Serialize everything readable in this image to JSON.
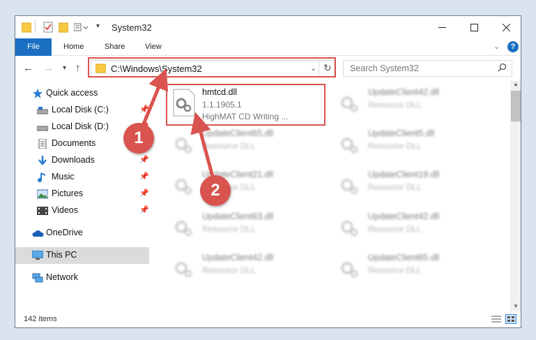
{
  "window": {
    "title": "System32",
    "minimize_icon": "minimize-icon",
    "maximize_icon": "maximize-icon",
    "close_icon": "close-icon"
  },
  "ribbon": {
    "tabs": [
      "File",
      "Home",
      "Share",
      "View"
    ]
  },
  "address": {
    "path": "C:\\Windows\\System32",
    "search_placeholder": "Search System32"
  },
  "sidebar": {
    "items": [
      {
        "label": "Quick access",
        "pinned": false
      },
      {
        "label": "Local Disk (C:)",
        "pinned": true
      },
      {
        "label": "Local Disk (D:)",
        "pinned": true
      },
      {
        "label": "Documents",
        "pinned": true
      },
      {
        "label": "Downloads",
        "pinned": true
      },
      {
        "label": "Music",
        "pinned": true
      },
      {
        "label": "Pictures",
        "pinned": true
      },
      {
        "label": "Videos",
        "pinned": true
      },
      {
        "label": "OneDrive",
        "pinned": false
      },
      {
        "label": "This PC",
        "pinned": false
      },
      {
        "label": "Network",
        "pinned": false
      }
    ]
  },
  "files": {
    "highlighted": {
      "name": "hmtcd.dll",
      "version": "1.1.1905.1",
      "description": "HighMAT CD Writing ..."
    },
    "blurred_left": [
      {
        "name": "UpdateClient65.dll",
        "type": "Resource DLL"
      },
      {
        "name": "UpdateClient21.dll",
        "type": "Resource DLL"
      },
      {
        "name": "UpdateClient63.dll",
        "type": "Resource DLL"
      },
      {
        "name": "UpdateClient42.dll",
        "type": "Resource DLL"
      }
    ],
    "blurred_right": [
      {
        "name": "UpdateClient42.dll",
        "type": "Resource DLL"
      },
      {
        "name": "UpdateClient5.dll",
        "type": "Resource DLL"
      },
      {
        "name": "UpdateClient19.dll",
        "type": "Resource DLL"
      },
      {
        "name": "UpdateClient42.dll",
        "type": "Resource DLL"
      },
      {
        "name": "UpdateClient65.dll",
        "type": "Resource DLL"
      }
    ]
  },
  "status": {
    "item_count": "142 items"
  },
  "annotations": {
    "marker1": "1",
    "marker2": "2",
    "color": "#d9534f"
  },
  "colors": {
    "accent": "#1a6fc3",
    "highlight": "#d9534f"
  }
}
